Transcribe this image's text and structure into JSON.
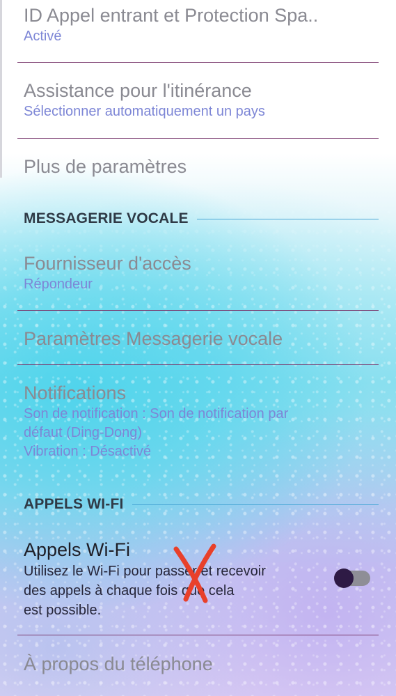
{
  "settings": {
    "caller_id": {
      "title": "ID Appel entrant et Protection Spa..",
      "subtitle": "Activé"
    },
    "roaming": {
      "title": "Assistance pour l'itinérance",
      "subtitle": "Sélectionner automatiquement un pays"
    },
    "more_settings": {
      "title": "Plus de paramètres"
    },
    "voicemail_section": {
      "label": "MESSAGERIE VOCALE"
    },
    "provider": {
      "title": "Fournisseur d'accès",
      "subtitle": "Répondeur"
    },
    "voicemail_settings": {
      "title": "Paramètres Messagerie vocale"
    },
    "notifications": {
      "title": "Notifications",
      "line1": "Son de notification : Son de notification par",
      "line2": "défaut (Ding-Dong)",
      "line3": "Vibration : Désactivé"
    },
    "wifi_section": {
      "label": "APPELS WI-FI"
    },
    "wifi_calling": {
      "title": "Appels Wi-Fi",
      "line1": "Utilisez le Wi-Fi pour passer et recevoir",
      "line2": "des appels à chaque fois que cela",
      "line3": "est possible.",
      "toggle_on": false
    },
    "about_phone": {
      "title": "À propos du téléphone"
    }
  },
  "annotation": {
    "icon": "red-cross-mark-icon",
    "color": "#e8402a"
  },
  "colors": {
    "divider": "#7a3a6e",
    "subtitle": "#7d86d6",
    "section_line": "#4aa8d6",
    "toggle_knob": "#2e1a45",
    "toggle_track": "#8e8e96"
  }
}
